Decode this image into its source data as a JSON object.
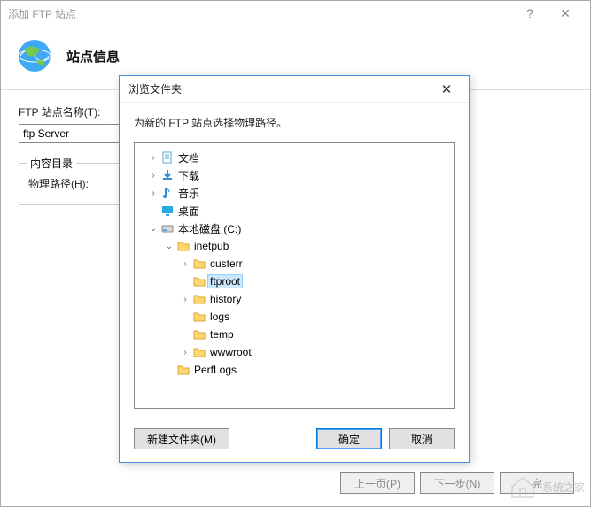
{
  "main": {
    "title": "添加 FTP 站点",
    "heading": "站点信息",
    "siteNameLabel": "FTP 站点名称(T):",
    "siteNameValue": "ftp Server",
    "contentDirLegend": "内容目录",
    "physicalPathLabel": "物理路径(H):"
  },
  "dialog": {
    "title": "浏览文件夹",
    "prompt": "为新的 FTP 站点选择物理路径。",
    "tree": [
      {
        "indent": 0,
        "expander": "›",
        "icon": "doc",
        "label": "文档"
      },
      {
        "indent": 0,
        "expander": "›",
        "icon": "download",
        "label": "下载"
      },
      {
        "indent": 0,
        "expander": "›",
        "icon": "music",
        "label": "音乐"
      },
      {
        "indent": 0,
        "expander": "",
        "icon": "desktop",
        "label": "桌面"
      },
      {
        "indent": 0,
        "expander": "⌄",
        "icon": "disk",
        "label": "本地磁盘 (C:)"
      },
      {
        "indent": 1,
        "expander": "⌄",
        "icon": "folder",
        "label": "inetpub"
      },
      {
        "indent": 2,
        "expander": "›",
        "icon": "folder",
        "label": "custerr"
      },
      {
        "indent": 2,
        "expander": "",
        "icon": "folder",
        "label": "ftproot",
        "selected": true
      },
      {
        "indent": 2,
        "expander": "›",
        "icon": "folder",
        "label": "history"
      },
      {
        "indent": 2,
        "expander": "",
        "icon": "folder",
        "label": "logs"
      },
      {
        "indent": 2,
        "expander": "",
        "icon": "folder",
        "label": "temp"
      },
      {
        "indent": 2,
        "expander": "›",
        "icon": "folder",
        "label": "wwwroot"
      },
      {
        "indent": 1,
        "expander": "",
        "icon": "folder",
        "label": "PerfLogs"
      }
    ],
    "newFolder": "新建文件夹(M)",
    "ok": "确定",
    "cancel": "取消"
  },
  "wizard": {
    "back": "上一页(P)",
    "next": "下一步(N)",
    "finishPrefix": "完"
  },
  "watermark": {
    "text": "系统之家"
  }
}
